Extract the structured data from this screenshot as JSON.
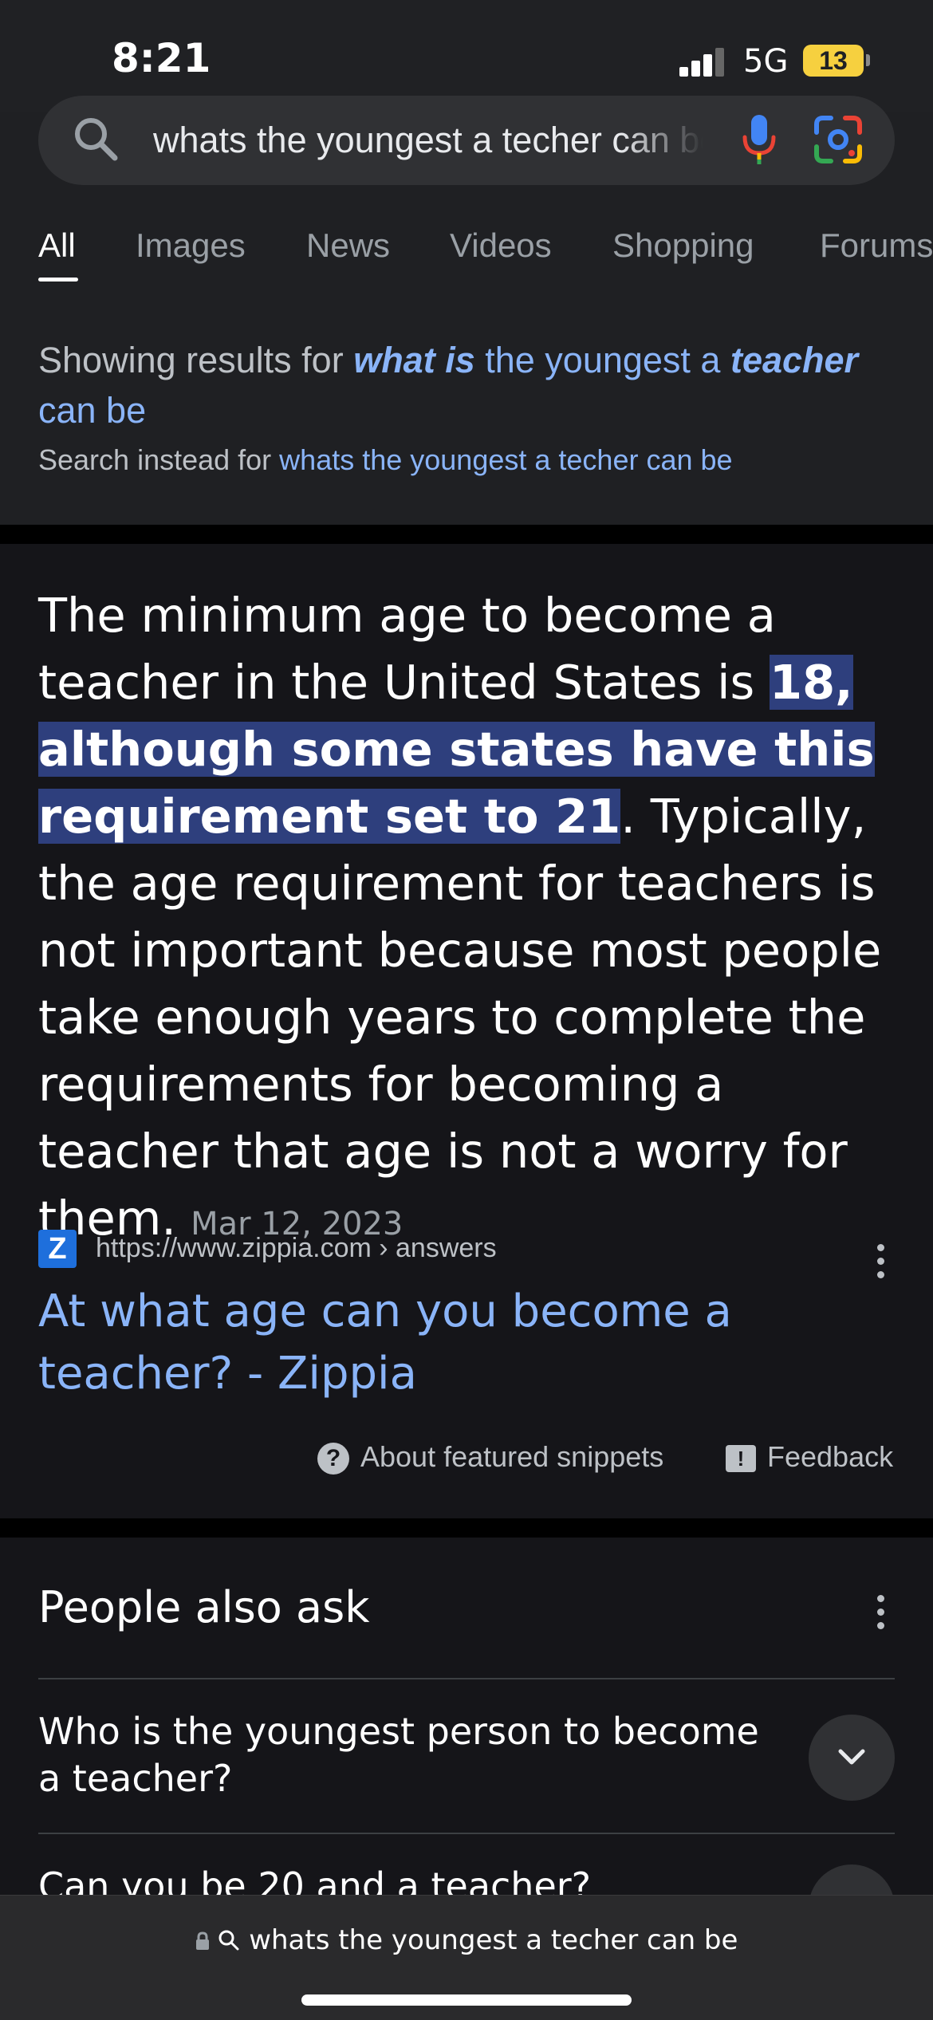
{
  "status_bar": {
    "time": "8:21",
    "network": "5G",
    "battery": "13"
  },
  "search": {
    "query": "whats the youngest a techer can be"
  },
  "tabs": [
    {
      "label": "All"
    },
    {
      "label": "Images"
    },
    {
      "label": "News"
    },
    {
      "label": "Videos"
    },
    {
      "label": "Shopping"
    },
    {
      "label": "Forums"
    }
  ],
  "spell_correction": {
    "showing_prefix": "Showing results for ",
    "corrected_em1": "what is",
    "corrected_mid": " the youngest a ",
    "corrected_em2": "teacher",
    "corrected_end": " can be",
    "instead_prefix": "Search instead for ",
    "instead_query": "whats the youngest a techer can be"
  },
  "snippet": {
    "text_before": "The minimum age to become a teacher in the United States is ",
    "highlight": "18, although some states have this requirement set to 21",
    "text_after": ". Typically, the age requirement for teachers is not important because most people take enough years to complete the requirements for becoming a teacher that age is not a worry for them.",
    "date": "Mar 12, 2023",
    "source_icon": "Z",
    "source_url": "https://www.zippia.com › answers",
    "result_title": "At what age can you become a teacher? - Zippia",
    "about_label": "About featured snippets",
    "feedback_label": "Feedback"
  },
  "people_also_ask": {
    "title": "People also ask",
    "questions": [
      "Who is the youngest person to become a teacher?",
      "Can you be 20 and a teacher?"
    ]
  },
  "bottom_bar": {
    "address": "whats the youngest a techer can be"
  },
  "colors": {
    "background": "#1f2023",
    "card": "#151519",
    "link": "#8ab4f8",
    "highlight": "#2e3f7d",
    "battery": "#f6d03f"
  }
}
